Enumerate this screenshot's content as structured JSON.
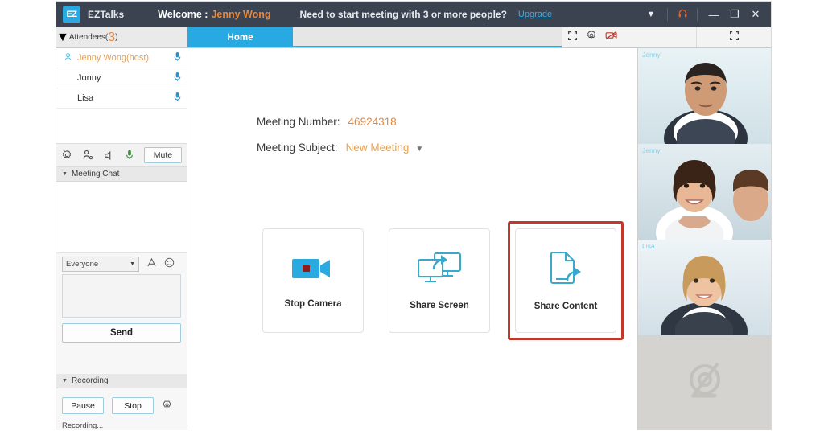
{
  "titlebar": {
    "logo_text": "EZ",
    "brand": "EZTalks",
    "welcome_label": "Welcome :",
    "user_name": "Jenny Wong",
    "promo_text": "Need to start meeting with 3 or more people?",
    "upgrade_label": "Upgrade",
    "caret_icon": "chevron-down-icon",
    "headset_icon": "headset-icon",
    "minimize_label": "—",
    "maximize_label": "❐",
    "close_label": "✕",
    "accent_dark": "#3b4351",
    "accent_orange": "#e8883a",
    "accent_blue": "#29a9e1"
  },
  "tabs": {
    "home_label": "Home",
    "grid_icon": "expand-grid-icon",
    "gear_icon": "gear-icon",
    "camera_off_icon": "camera-off-icon",
    "fullscreen_icon": "fullscreen-grid-icon"
  },
  "sidebar": {
    "attendees": {
      "section_label": "Attendees(",
      "count": "3",
      "section_label_end": ")",
      "items": [
        {
          "name": "Jenny Wong(host)",
          "host": true,
          "mic_icon": "microphone-icon",
          "host_icon": "host-badge-icon"
        },
        {
          "name": "Jonny",
          "host": false,
          "mic_icon": "microphone-icon"
        },
        {
          "name": "Lisa",
          "host": false,
          "mic_icon": "microphone-icon"
        }
      ]
    },
    "controls": {
      "settings_icon": "gear-icon",
      "invite_icon": "add-person-icon",
      "speaker_icon": "speaker-icon",
      "mic_icon": "microphone-icon",
      "mute_label": "Mute"
    },
    "chat": {
      "section_label": "Meeting Chat",
      "recipient_selected": "Everyone",
      "font_icon": "font-icon",
      "emoji_icon": "emoji-icon",
      "message_value": "",
      "send_label": "Send"
    },
    "recording": {
      "section_label": "Recording",
      "pause_label": "Pause",
      "stop_label": "Stop",
      "settings_icon": "gear-icon",
      "status_text": "Recording..."
    }
  },
  "main": {
    "meeting_number_label": "Meeting Number:",
    "meeting_number_value": "46924318",
    "meeting_subject_label": "Meeting Subject:",
    "meeting_subject_value": "New Meeting",
    "subject_dropdown_icon": "chevron-down-icon",
    "cards": [
      {
        "label": "Stop Camera",
        "icon": "video-camera-icon",
        "highlighted": false
      },
      {
        "label": "Share Screen",
        "icon": "share-screen-icon",
        "highlighted": false
      },
      {
        "label": "Share Content",
        "icon": "share-document-icon",
        "highlighted": true
      }
    ],
    "highlight_color": "#c0392b"
  },
  "videos": {
    "participants": [
      {
        "label": "Jonny"
      },
      {
        "label": "Jenny"
      },
      {
        "label": "Lisa"
      }
    ],
    "empty_slot_icon": "camera-off-icon"
  }
}
